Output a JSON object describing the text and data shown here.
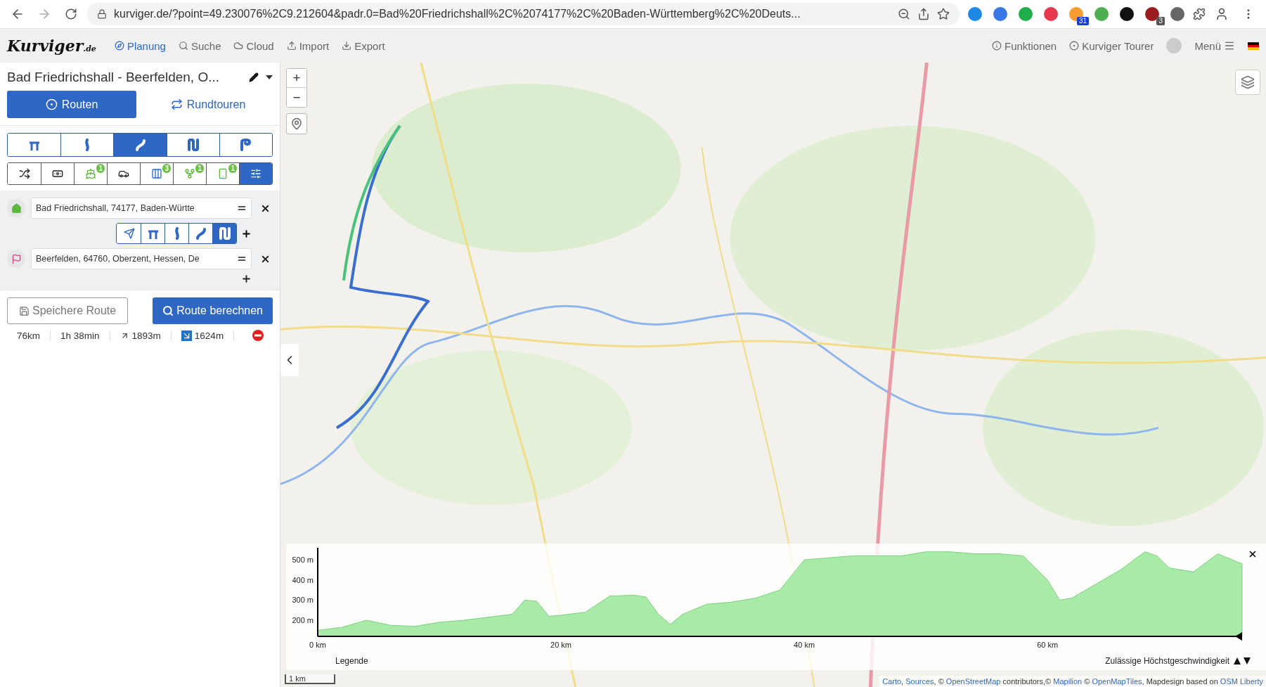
{
  "browser": {
    "url": "kurviger.de/?point=49.230076%2C9.212604&padr.0=Bad%20Friedrichshall%2C%2074177%2C%20Baden-Württemberg%2C%20Deuts...",
    "extension_badges": [
      "31",
      "3"
    ]
  },
  "nav": {
    "logo": "Kurviger",
    "logo_suffix": ".de",
    "items": [
      {
        "label": "Planung",
        "selected": true
      },
      {
        "label": "Suche",
        "selected": false
      },
      {
        "label": "Cloud",
        "selected": false
      },
      {
        "label": "Import",
        "selected": false
      },
      {
        "label": "Export",
        "selected": false
      }
    ],
    "right_items": [
      "Funktionen",
      "Kurviger Tourer"
    ],
    "menu": "Menü"
  },
  "panel": {
    "title": "Bad Friedrichshall - Beerfelden, O...",
    "mode_tabs": [
      {
        "label": "Routen",
        "selected": true
      },
      {
        "label": "Rundtouren",
        "selected": false
      }
    ],
    "route_types": [
      {
        "selected": false
      },
      {
        "selected": false
      },
      {
        "selected": true
      },
      {
        "selected": false
      },
      {
        "selected": false
      }
    ],
    "options": [
      {
        "selected": false
      },
      {
        "selected": false
      },
      {
        "badge": "1",
        "selected": false
      },
      {
        "selected": false
      },
      {
        "badge": "3",
        "selected": false
      },
      {
        "badge": "1",
        "selected": false
      },
      {
        "badge": "1",
        "selected": false
      },
      {
        "selected": true
      }
    ],
    "waypoints": [
      {
        "kind": "start",
        "value": "Bad Friedrichshall, 74177, Baden-Württe"
      },
      {
        "kind": "end",
        "value": "Beerfelden, 64760, Oberzent, Hessen, De"
      }
    ],
    "segment_types": [
      {
        "selected": false
      },
      {
        "selected": false
      },
      {
        "selected": false
      },
      {
        "selected": false
      },
      {
        "selected": true
      }
    ],
    "save_button": "Speichere Route",
    "calculate_button": "Route berechnen",
    "stats": {
      "distance": "76km",
      "duration": "1h 38min",
      "ascent": "1893m",
      "descent": "1624m"
    }
  },
  "map": {
    "zoom_in": "+",
    "zoom_out": "−",
    "scale": "1 km",
    "elevation": {
      "legend": "Legende",
      "mode": "Zulässige Höchstgeschwindigkeit",
      "chart_data": {
        "type": "area",
        "x": [
          0,
          2,
          4,
          6,
          8,
          10,
          12,
          14,
          16,
          17,
          18,
          19,
          20,
          22,
          24,
          26,
          27,
          28,
          29,
          30,
          32,
          34,
          36,
          38,
          40,
          42,
          44,
          46,
          48,
          50,
          52,
          54,
          56,
          58,
          60,
          61,
          62,
          64,
          66,
          68,
          69,
          70,
          72,
          74,
          76
        ],
        "series": [
          {
            "color": "#a8eaa8",
            "values": [
              150,
              165,
              200,
              175,
              170,
              190,
              200,
              215,
              230,
              300,
              295,
              220,
              225,
              240,
              320,
              325,
              315,
              230,
              180,
              230,
              280,
              290,
              310,
              350,
              500,
              510,
              520,
              520,
              520,
              540,
              540,
              530,
              530,
              520,
              400,
              300,
              310,
              380,
              450,
              540,
              520,
              460,
              440,
              530,
              480
            ]
          }
        ],
        "xlim": [
          0,
          76
        ],
        "ylim": [
          120,
          560
        ],
        "xticks": [
          {
            "value": 0,
            "label": "0 km"
          },
          {
            "value": 20,
            "label": "20 km"
          },
          {
            "value": 40,
            "label": "40 km"
          },
          {
            "value": 60,
            "label": "60 km"
          }
        ],
        "yticks": [
          {
            "value": 200,
            "label": "200 m"
          },
          {
            "value": 300,
            "label": "300 m"
          },
          {
            "value": 400,
            "label": "400 m"
          },
          {
            "value": 500,
            "label": "500 m"
          }
        ]
      }
    },
    "attribution": [
      {
        "kind": "link",
        "text": "Carto"
      },
      {
        "kind": "text",
        "text": ", "
      },
      {
        "kind": "link",
        "text": "Sources"
      },
      {
        "kind": "text",
        "text": ", © "
      },
      {
        "kind": "link",
        "text": "OpenStreetMap"
      },
      {
        "kind": "text",
        "text": " contributors,© "
      },
      {
        "kind": "link",
        "text": "Mapilion"
      },
      {
        "kind": "text",
        "text": " © "
      },
      {
        "kind": "link",
        "text": "OpenMapTiles"
      },
      {
        "kind": "text",
        "text": ", Mapdesign based on "
      },
      {
        "kind": "link",
        "text": "OSM Liberty"
      }
    ]
  }
}
